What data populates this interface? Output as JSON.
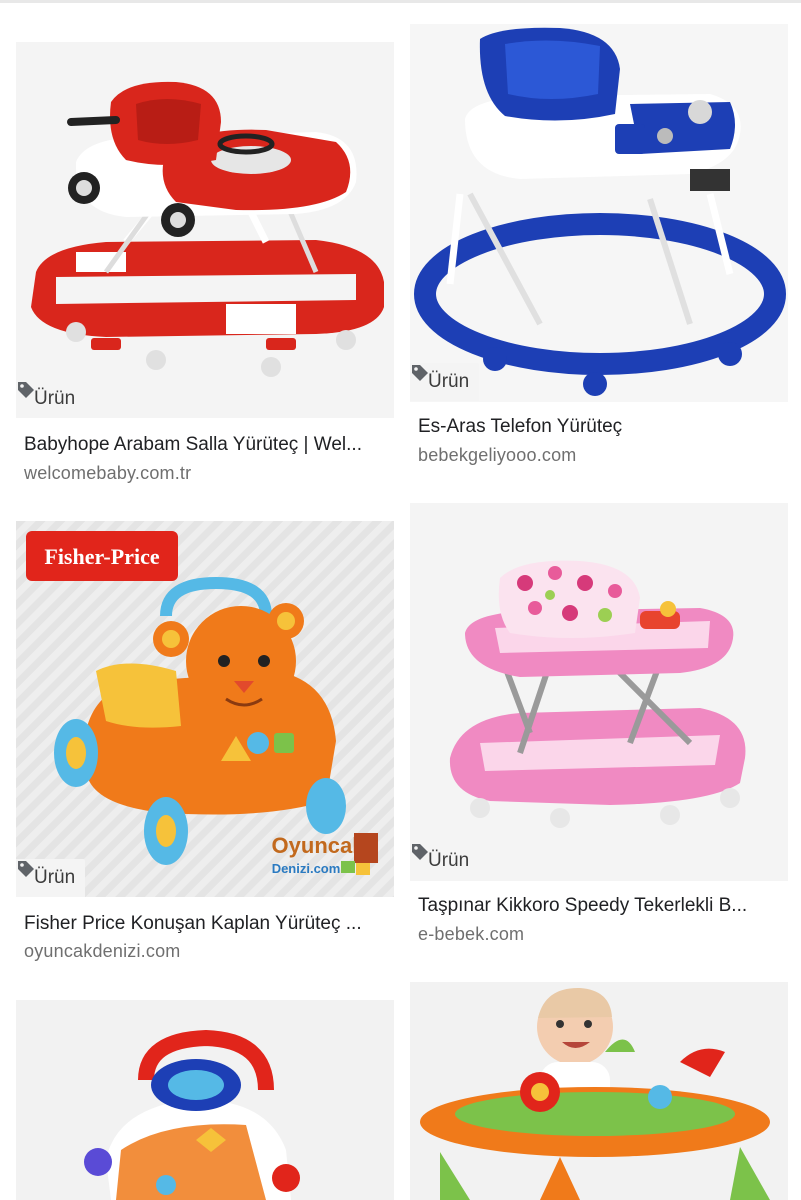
{
  "results": [
    {
      "chip": "Ürün",
      "title": "Babyhope Arabam Salla Yürüteç | Wel...",
      "source": "welcomebaby.com.tr",
      "icon": "tag-icon"
    },
    {
      "chip": "Ürün",
      "title": "Es-Aras Telefon Yürüteç",
      "source": "bebekgeliyooo.com",
      "icon": "tag-icon"
    },
    {
      "chip": "Ürün",
      "title": "Fisher Price Konuşan Kaplan Yürüteç ...",
      "source": "oyuncakdenizi.com",
      "icon": "tag-icon",
      "logo_text": "Fisher-Price",
      "watermark_line1": "Oyuncak",
      "watermark_line2": "Denizi.com"
    },
    {
      "chip": "Ürün",
      "title": "Taşpınar Kikkoro Speedy Tekerlekli B...",
      "source": "e-bebek.com",
      "icon": "tag-icon"
    },
    {},
    {}
  ],
  "colors": {
    "red": "#d9261c",
    "blue": "#1d3fb5",
    "pink": "#f08ac2",
    "orange": "#f07a1a"
  }
}
